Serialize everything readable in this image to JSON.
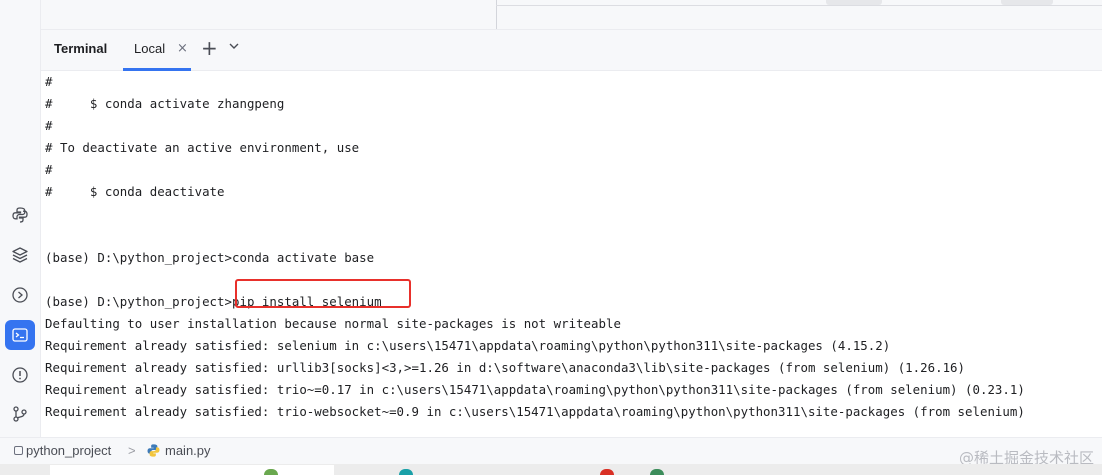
{
  "terminal": {
    "title": "Terminal",
    "tab_label": "Local",
    "tab_close": "×",
    "new_tab": "+",
    "lines": [
      "#",
      "#     $ conda activate zhangpeng",
      "#",
      "# To deactivate an active environment, use",
      "#",
      "#     $ conda deactivate",
      "",
      "",
      "(base) D:\\python_project>conda activate base",
      "",
      "(base) D:\\python_project>pip install selenium",
      "Defaulting to user installation because normal site-packages is not writeable",
      "Requirement already satisfied: selenium in c:\\users\\15471\\appdata\\roaming\\python\\python311\\site-packages (4.15.2)",
      "Requirement already satisfied: urllib3[socks]<3,>=1.26 in d:\\software\\anaconda3\\lib\\site-packages (from selenium) (1.26.16)",
      "Requirement already satisfied: trio~=0.17 in c:\\users\\15471\\appdata\\roaming\\python\\python311\\site-packages (from selenium) (0.23.1)",
      "Requirement already satisfied: trio-websocket~=0.9 in c:\\users\\15471\\appdata\\roaming\\python\\python311\\site-packages (from selenium)"
    ]
  },
  "status_bar": {
    "project": "python_project",
    "separator": ">",
    "file": "main.py"
  },
  "watermark": "@稀土掘金技术社区",
  "sidebar": {
    "icons": [
      "python-packages-icon",
      "layers-icon",
      "services-icon",
      "terminal-icon",
      "problems-icon",
      "git-icon"
    ]
  },
  "colors": {
    "accent": "#3574f0",
    "highlight_box": "#e8302b",
    "terminal_bg": "#ffffff",
    "chrome_bg": "#f7f8fa"
  }
}
